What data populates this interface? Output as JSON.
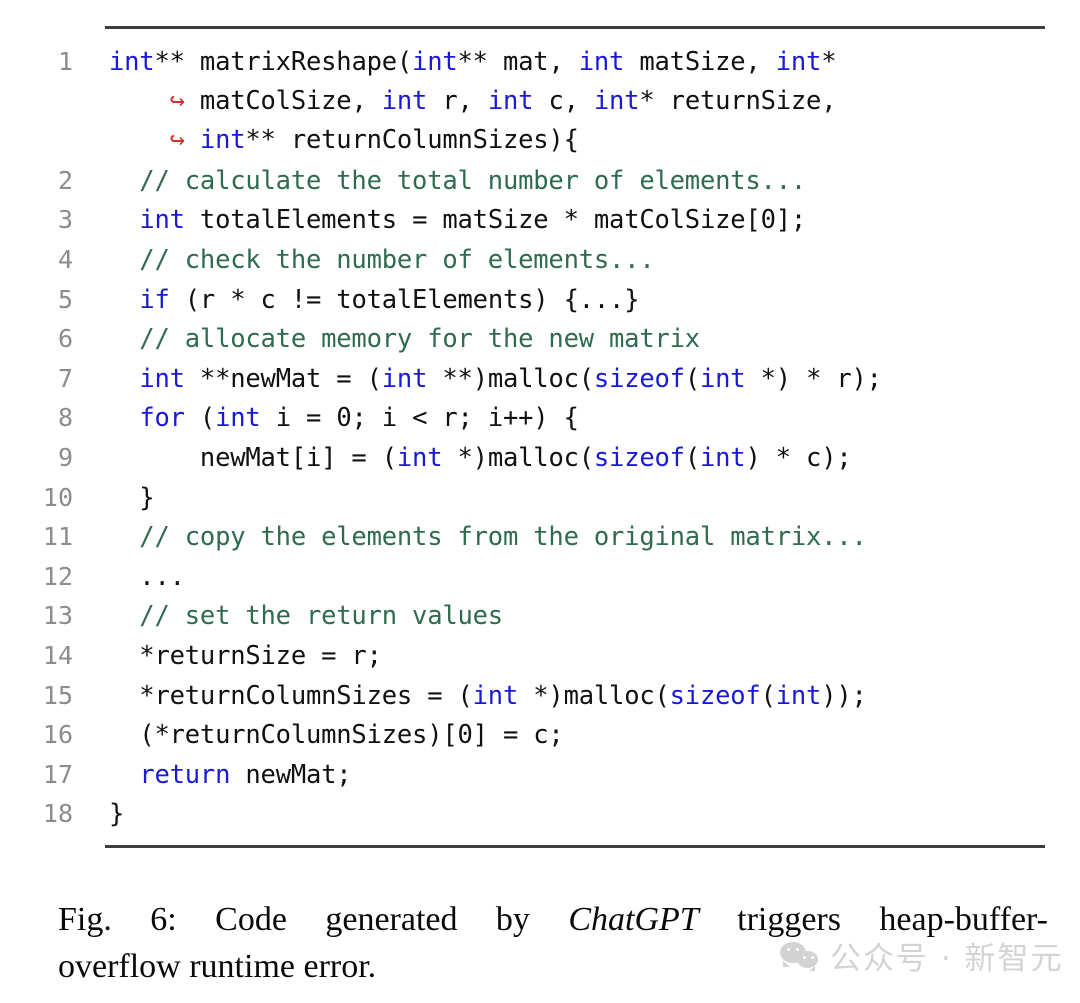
{
  "figure": {
    "rule_color": "#3d3d42",
    "code": {
      "language": "c",
      "keyword_color": "#1a1ad6",
      "comment_color": "#2f6b4e",
      "arrow_color": "#cc3333",
      "lineno_color": "#8c8c8c",
      "continuation_arrow": "↪",
      "lines": [
        {
          "number": "1",
          "rows": [
            {
              "tokens": [
                {
                  "t": "int",
                  "c": "kw"
                },
                {
                  "t": "** matrixReshape(",
                  "c": "plain"
                },
                {
                  "t": "int",
                  "c": "kw"
                },
                {
                  "t": "** mat, ",
                  "c": "plain"
                },
                {
                  "t": "int",
                  "c": "kw"
                },
                {
                  "t": " matSize, ",
                  "c": "plain"
                },
                {
                  "t": "int",
                  "c": "kw"
                },
                {
                  "t": "*",
                  "c": "plain"
                }
              ]
            },
            {
              "cont": true,
              "tokens": [
                {
                  "t": "    ↪ ",
                  "c": "arrow"
                },
                {
                  "t": "matColSize, ",
                  "c": "plain"
                },
                {
                  "t": "int",
                  "c": "kw"
                },
                {
                  "t": " r, ",
                  "c": "plain"
                },
                {
                  "t": "int",
                  "c": "kw"
                },
                {
                  "t": " c, ",
                  "c": "plain"
                },
                {
                  "t": "int",
                  "c": "kw"
                },
                {
                  "t": "* returnSize,",
                  "c": "plain"
                }
              ]
            },
            {
              "cont": true,
              "tokens": [
                {
                  "t": "    ↪ ",
                  "c": "arrow"
                },
                {
                  "t": "int",
                  "c": "kw"
                },
                {
                  "t": "** returnColumnSizes){",
                  "c": "plain"
                }
              ]
            }
          ]
        },
        {
          "number": "2",
          "rows": [
            {
              "tokens": [
                {
                  "t": "  // calculate the total number of elements...",
                  "c": "cmt"
                }
              ]
            }
          ]
        },
        {
          "number": "3",
          "rows": [
            {
              "tokens": [
                {
                  "t": "  ",
                  "c": "plain"
                },
                {
                  "t": "int",
                  "c": "kw"
                },
                {
                  "t": " totalElements = matSize * matColSize[0];",
                  "c": "plain"
                }
              ]
            }
          ]
        },
        {
          "number": "4",
          "rows": [
            {
              "tokens": [
                {
                  "t": "  // check the number of elements...",
                  "c": "cmt"
                }
              ]
            }
          ]
        },
        {
          "number": "5",
          "rows": [
            {
              "tokens": [
                {
                  "t": "  ",
                  "c": "plain"
                },
                {
                  "t": "if",
                  "c": "kw"
                },
                {
                  "t": " (r * c != totalElements) {...}",
                  "c": "plain"
                }
              ]
            }
          ]
        },
        {
          "number": "6",
          "rows": [
            {
              "tokens": [
                {
                  "t": "  // allocate memory for the new matrix",
                  "c": "cmt"
                }
              ]
            }
          ]
        },
        {
          "number": "7",
          "rows": [
            {
              "tokens": [
                {
                  "t": "  ",
                  "c": "plain"
                },
                {
                  "t": "int",
                  "c": "kw"
                },
                {
                  "t": " **newMat = (",
                  "c": "plain"
                },
                {
                  "t": "int",
                  "c": "kw"
                },
                {
                  "t": " **)malloc(",
                  "c": "plain"
                },
                {
                  "t": "sizeof",
                  "c": "kw"
                },
                {
                  "t": "(",
                  "c": "plain"
                },
                {
                  "t": "int",
                  "c": "kw"
                },
                {
                  "t": " *) * r);",
                  "c": "plain"
                }
              ]
            }
          ]
        },
        {
          "number": "8",
          "rows": [
            {
              "tokens": [
                {
                  "t": "  ",
                  "c": "plain"
                },
                {
                  "t": "for",
                  "c": "kw"
                },
                {
                  "t": " (",
                  "c": "plain"
                },
                {
                  "t": "int",
                  "c": "kw"
                },
                {
                  "t": " i = 0; i < r; i++) {",
                  "c": "plain"
                }
              ]
            }
          ]
        },
        {
          "number": "9",
          "rows": [
            {
              "tokens": [
                {
                  "t": "      newMat[i] = (",
                  "c": "plain"
                },
                {
                  "t": "int",
                  "c": "kw"
                },
                {
                  "t": " *)malloc(",
                  "c": "plain"
                },
                {
                  "t": "sizeof",
                  "c": "kw"
                },
                {
                  "t": "(",
                  "c": "plain"
                },
                {
                  "t": "int",
                  "c": "kw"
                },
                {
                  "t": ") * c);",
                  "c": "plain"
                }
              ]
            }
          ]
        },
        {
          "number": "10",
          "rows": [
            {
              "tokens": [
                {
                  "t": "  }",
                  "c": "plain"
                }
              ]
            }
          ]
        },
        {
          "number": "11",
          "rows": [
            {
              "tokens": [
                {
                  "t": "  // copy the elements from the original matrix...",
                  "c": "cmt"
                }
              ]
            }
          ]
        },
        {
          "number": "12",
          "rows": [
            {
              "tokens": [
                {
                  "t": "  ...",
                  "c": "plain"
                }
              ]
            }
          ]
        },
        {
          "number": "13",
          "rows": [
            {
              "tokens": [
                {
                  "t": "  // set the return values",
                  "c": "cmt"
                }
              ]
            }
          ]
        },
        {
          "number": "14",
          "rows": [
            {
              "tokens": [
                {
                  "t": "  *returnSize = r;",
                  "c": "plain"
                }
              ]
            }
          ]
        },
        {
          "number": "15",
          "rows": [
            {
              "tokens": [
                {
                  "t": "  *returnColumnSizes = (",
                  "c": "plain"
                },
                {
                  "t": "int",
                  "c": "kw"
                },
                {
                  "t": " *)malloc(",
                  "c": "plain"
                },
                {
                  "t": "sizeof",
                  "c": "kw"
                },
                {
                  "t": "(",
                  "c": "plain"
                },
                {
                  "t": "int",
                  "c": "kw"
                },
                {
                  "t": "));",
                  "c": "plain"
                }
              ]
            }
          ]
        },
        {
          "number": "16",
          "rows": [
            {
              "tokens": [
                {
                  "t": "  (*returnColumnSizes)[0] = c;",
                  "c": "plain"
                }
              ]
            }
          ]
        },
        {
          "number": "17",
          "rows": [
            {
              "tokens": [
                {
                  "t": "  ",
                  "c": "plain"
                },
                {
                  "t": "return",
                  "c": "kw"
                },
                {
                  "t": " newMat;",
                  "c": "plain"
                }
              ]
            }
          ]
        },
        {
          "number": "18",
          "rows": [
            {
              "tokens": [
                {
                  "t": "}",
                  "c": "plain"
                }
              ]
            }
          ]
        }
      ]
    },
    "caption": {
      "line1_prefix": "Fig. 6:  Code  generated  by ",
      "line1_italic": "ChatGPT",
      "line1_suffix": " triggers  heap-buffer-",
      "line2": "overflow runtime error."
    },
    "watermark": {
      "text": "公众号 · 新智元",
      "color": "#b9b9b9"
    }
  }
}
